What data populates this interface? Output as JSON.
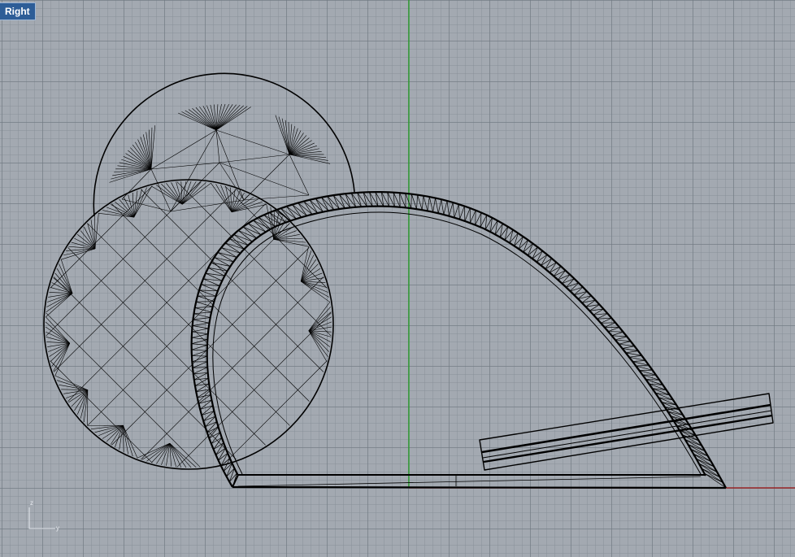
{
  "viewport": {
    "label": "Right",
    "colors": {
      "background": "#a3a9b1",
      "grid_major": "#6e7680",
      "grid_minor": "#878e97",
      "vertical_axis": "#1aa01a",
      "horizontal_axis": "#9b1010",
      "geometry": "#000000",
      "label_bg": "#2d5d97"
    }
  },
  "axis_gizmo": {
    "up_label": "z",
    "side_label": "y"
  }
}
